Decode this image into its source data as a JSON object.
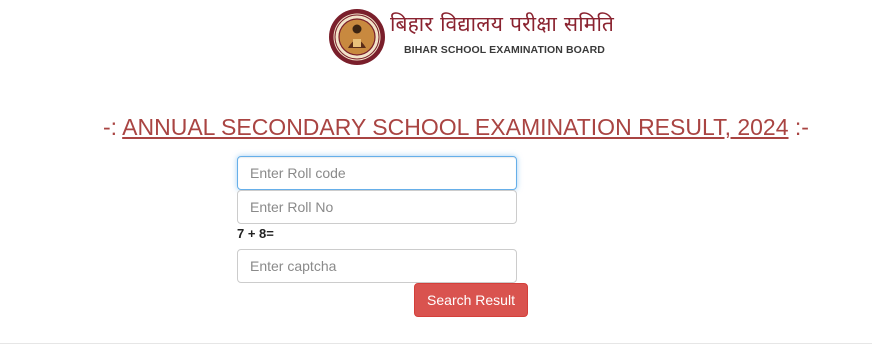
{
  "header": {
    "brand_hindi": "बिहार विद्यालय परीक्षा समिति",
    "brand_english": "BIHAR SCHOOL EXAMINATION BOARD",
    "seal_icon": "bseb-seal-icon"
  },
  "title": {
    "prefix": "-: ",
    "text": "ANNUAL SECONDARY SCHOOL EXAMINATION RESULT, 2024",
    "suffix": " :-"
  },
  "form": {
    "roll_code": {
      "placeholder": "Enter Roll code",
      "value": ""
    },
    "roll_no": {
      "placeholder": "Enter Roll No",
      "value": ""
    },
    "captcha_question": "7 + 8=",
    "captcha": {
      "placeholder": "Enter captcha",
      "value": ""
    },
    "submit_label": "Search Result"
  },
  "colors": {
    "title": "#a94442",
    "button": "#d9534f",
    "brand": "#8a2330"
  }
}
